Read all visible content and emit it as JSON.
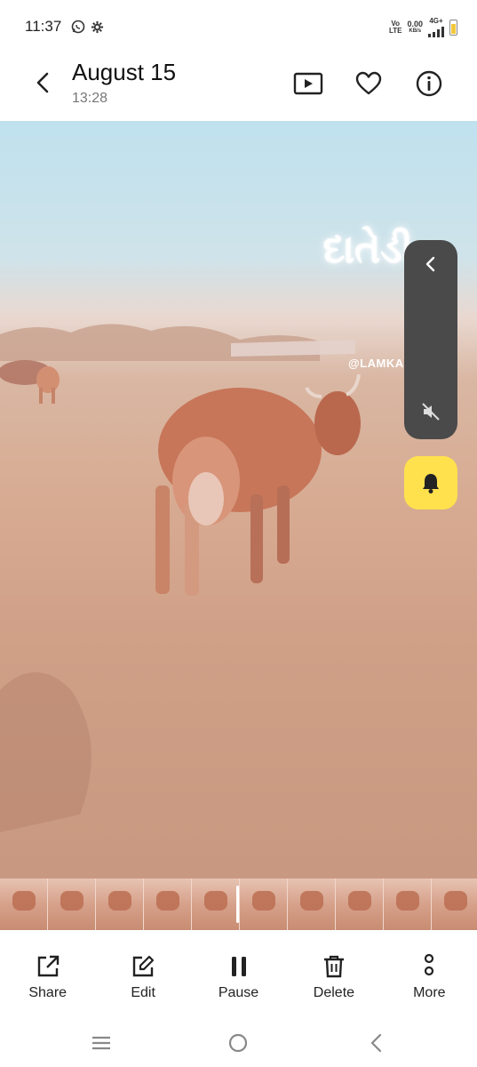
{
  "status_bar": {
    "time": "11:37",
    "network_top": "Vo",
    "network_bottom": "LTE",
    "speed_value": "0.00",
    "speed_unit": "KB/s",
    "cellular": "4G+",
    "icons": [
      "whatsapp-icon",
      "settings-gear-icon",
      "signal-icon",
      "battery-icon"
    ]
  },
  "header": {
    "title": "August 15",
    "subtitle": "13:28",
    "icons": [
      "back-icon",
      "slideshow-icon",
      "favorite-icon",
      "info-icon"
    ]
  },
  "photo": {
    "overlay_text": "દાતેડી",
    "watermark": "@LAMKA."
  },
  "side_panel": {
    "icons": [
      "collapse-icon",
      "mute-icon",
      "bell-icon"
    ],
    "accent": "#ffe14d"
  },
  "filmstrip": {
    "frame_count": 10
  },
  "actions": [
    {
      "label": "Share",
      "icon": "share-icon"
    },
    {
      "label": "Edit",
      "icon": "edit-icon"
    },
    {
      "label": "Pause",
      "icon": "pause-icon"
    },
    {
      "label": "Delete",
      "icon": "delete-icon"
    },
    {
      "label": "More",
      "icon": "more-icon"
    }
  ],
  "navbar": {
    "icons": [
      "menu-icon",
      "home-icon",
      "back-nav-icon"
    ]
  }
}
